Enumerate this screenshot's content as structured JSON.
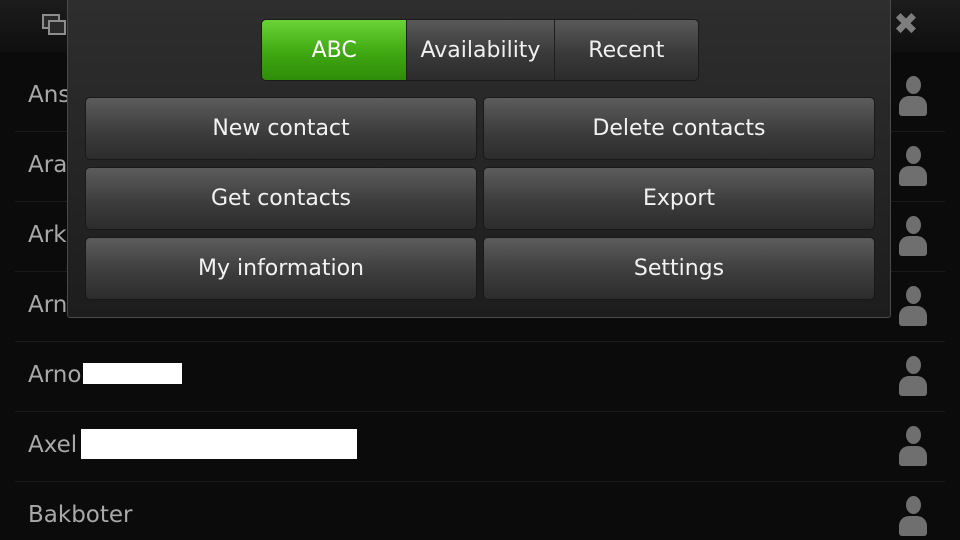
{
  "menu": {
    "filters": [
      {
        "label": "ABC",
        "active": true
      },
      {
        "label": "Availability",
        "active": false
      },
      {
        "label": "Recent",
        "active": false
      }
    ],
    "actions": [
      {
        "label": "New contact"
      },
      {
        "label": "Delete contacts"
      },
      {
        "label": "Get contacts"
      },
      {
        "label": "Export"
      },
      {
        "label": "My information"
      },
      {
        "label": "Settings"
      }
    ]
  },
  "topbar": {
    "switcher_icon": "task-switcher-icon",
    "close_icon": "close-icon",
    "close_glyph": "✖"
  },
  "contacts": [
    {
      "name": "Ans"
    },
    {
      "name": "Arar"
    },
    {
      "name": "Arki"
    },
    {
      "name": "Arne"
    },
    {
      "name": "Arno"
    },
    {
      "name": "Axel"
    },
    {
      "name": "Bakboter"
    }
  ],
  "colors": {
    "active_filter": "#3fa812",
    "background": "#0b0b0b",
    "menu": "#2a2a2a"
  }
}
